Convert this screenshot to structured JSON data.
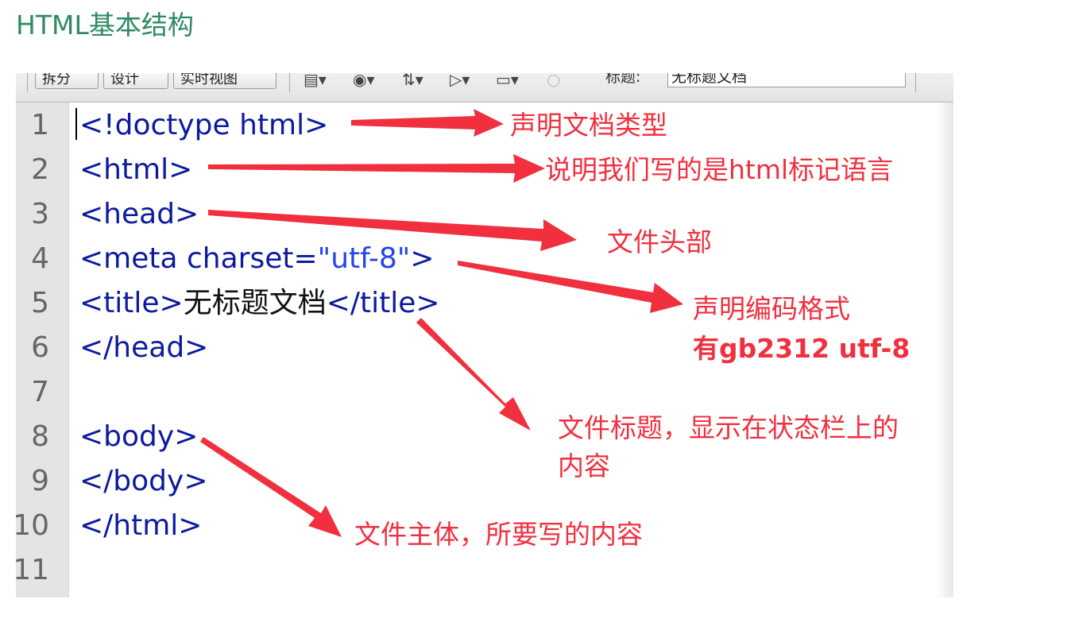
{
  "page": {
    "heading": "HTML基本结构"
  },
  "toolbar": {
    "split_label": "拆分",
    "design_label": "设计",
    "live_view_label": "实时视图",
    "title_label": "标题:",
    "title_value": "无标题文档"
  },
  "editor": {
    "line_numbers": [
      "1",
      "2",
      "3",
      "4",
      "5",
      "6",
      "7",
      "8",
      "9",
      "10",
      "11"
    ],
    "lines": {
      "l1": "<!doctype html>",
      "l2": "<html>",
      "l3": "<head>",
      "l4_pre": "<meta charset=",
      "l4_str": "\"utf-8\"",
      "l4_post": ">",
      "l5_open": "<title>",
      "l5_text": "无标题文档",
      "l5_close": "</title>",
      "l6": "</head>",
      "l8": "<body>",
      "l9": "</body>",
      "l10": "</html>"
    }
  },
  "annotations": {
    "doctype": "声明文档类型",
    "html": "说明我们写的是html标记语言",
    "head": "文件头部",
    "meta_line1": "声明编码格式",
    "meta_line2": "有gb2312  utf-8",
    "title_line1": "文件标题，显示在状态栏上的",
    "title_line2": "内容",
    "body": "文件主体，所要写的内容"
  },
  "colors": {
    "heading": "#2e8a63",
    "annotation": "#f0303f",
    "code_tag": "#0b1a9e",
    "arrow": "#f0303f"
  }
}
